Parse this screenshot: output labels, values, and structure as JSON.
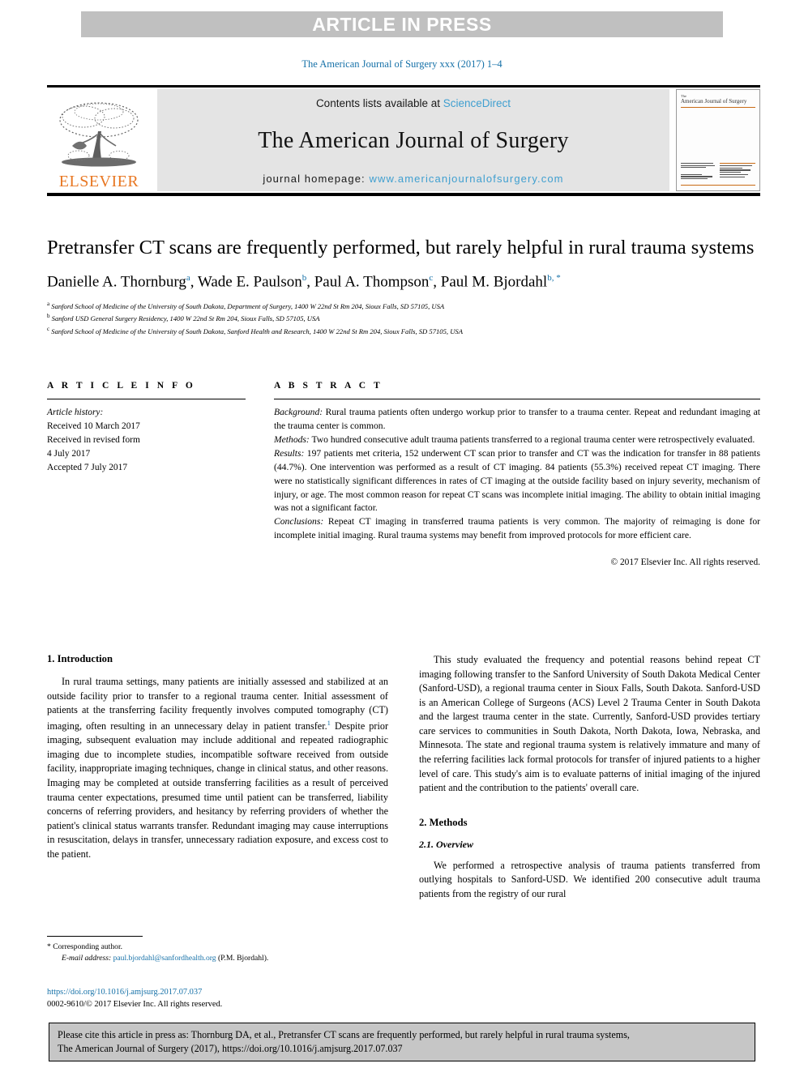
{
  "banner": {
    "text": "ARTICLE IN PRESS"
  },
  "running_head": "The American Journal of Surgery xxx (2017) 1–4",
  "masthead": {
    "contents_prefix": "Contents lists available at ",
    "sciencedirect": "ScienceDirect",
    "journal_title": "The American Journal of Surgery",
    "homepage_prefix": "journal homepage: ",
    "homepage_url": "www.americanjournalofsurgery.com",
    "publisher_logo_text": "ELSEVIER",
    "cover_title_small": "The",
    "cover_title_main": "American Journal of Surgery"
  },
  "article": {
    "title": "Pretransfer CT scans are frequently performed, but rarely helpful in rural trauma systems",
    "authors": [
      {
        "name": "Danielle A. Thornburg",
        "mark": "a"
      },
      {
        "name": "Wade E. Paulson",
        "mark": "b"
      },
      {
        "name": "Paul A. Thompson",
        "mark": "c"
      },
      {
        "name": "Paul M. Bjordahl",
        "mark": "b, *"
      }
    ],
    "affiliations": [
      {
        "mark": "a",
        "text": "Sanford School of Medicine of the University of South Dakota, Department of Surgery, 1400 W 22nd St Rm 204, Sioux Falls, SD 57105, USA"
      },
      {
        "mark": "b",
        "text": "Sanford USD General Surgery Residency, 1400 W 22nd St Rm 204, Sioux Falls, SD 57105, USA"
      },
      {
        "mark": "c",
        "text": "Sanford School of Medicine of the University of South Dakota, Sanford Health and Research, 1400 W 22nd St Rm 204, Sioux Falls, SD 57105, USA"
      }
    ]
  },
  "article_info": {
    "heading": "A R T I C L E   I N F O",
    "history_label": "Article history:",
    "history_lines": [
      "Received 10 March 2017",
      "Received in revised form",
      "4 July 2017",
      "Accepted 7 July 2017"
    ]
  },
  "abstract": {
    "heading": "A B S T R A C T",
    "sections": [
      {
        "label": "Background:",
        "text": " Rural trauma patients often undergo workup prior to transfer to a trauma center. Repeat and redundant imaging at the trauma center is common."
      },
      {
        "label": "Methods:",
        "text": " Two hundred consecutive adult trauma patients transferred to a regional trauma center were retrospectively evaluated."
      },
      {
        "label": "Results:",
        "text": " 197 patients met criteria, 152 underwent CT scan prior to transfer and CT was the indication for transfer in 88 patients (44.7%). One intervention was performed as a result of CT imaging. 84 patients (55.3%) received repeat CT imaging. There were no statistically significant differences in rates of CT imaging at the outside facility based on injury severity, mechanism of injury, or age. The most common reason for repeat CT scans was incomplete initial imaging. The ability to obtain initial imaging was not a significant factor."
      },
      {
        "label": "Conclusions:",
        "text": " Repeat CT imaging in transferred trauma patients is very common. The majority of reimaging is done for incomplete initial imaging. Rural trauma systems may benefit from improved protocols for more efficient care."
      }
    ],
    "copyright": "© 2017 Elsevier Inc. All rights reserved."
  },
  "body": {
    "left_column": {
      "section_heading": "1. Introduction",
      "paragraph_1_part1": "In rural trauma settings, many patients are initially assessed and stabilized at an outside facility prior to transfer to a regional trauma center. Initial assessment of patients at the transferring facility frequently involves computed tomography (CT) imaging, often resulting in an unnecessary delay in patient transfer.",
      "paragraph_1_ref": "1",
      "paragraph_1_part2": " Despite prior imaging, subsequent evaluation may include additional and repeated radiographic imaging due to incomplete studies, incompatible software received from outside facility, inappropriate imaging techniques, change in clinical status, and other reasons. Imaging may be completed at outside transferring facilities as a result of perceived trauma center expectations, presumed time until patient can be transferred, liability concerns of referring providers, and hesitancy by referring providers of whether the patient's clinical status warrants transfer. Redundant imaging may cause interruptions in resuscitation, delays in transfer, unnecessary radiation exposure, and excess cost to the patient."
    },
    "right_column": {
      "paragraph_1": "This study evaluated the frequency and potential reasons behind repeat CT imaging following transfer to the Sanford University of South Dakota Medical Center (Sanford-USD), a regional trauma center in Sioux Falls, South Dakota. Sanford-USD is an American College of Surgeons (ACS) Level 2 Trauma Center in South Dakota and the largest trauma center in the state. Currently, Sanford-USD provides tertiary care services to communities in South Dakota, North Dakota, Iowa, Nebraska, and Minnesota. The state and regional trauma system is relatively immature and many of the referring facilities lack formal protocols for transfer of injured patients to a higher level of care. This study's aim is to evaluate patterns of initial imaging of the injured patient and the contribution to the patients' overall care.",
      "section_heading": "2. Methods",
      "subsection_heading": "2.1. Overview",
      "paragraph_2": "We performed a retrospective analysis of trauma patients transferred from outlying hospitals to Sanford-USD. We identified 200 consecutive adult trauma patients from the registry of our rural"
    }
  },
  "footnote": {
    "corresponding_marker": "*",
    "corresponding_label": "Corresponding author.",
    "email_label": "E-mail address:",
    "email": "paul.bjordahl@sanfordhealth.org",
    "email_suffix": " (P.M. Bjordahl)."
  },
  "doi_block": {
    "doi_url": "https://doi.org/10.1016/j.amjsurg.2017.07.037",
    "issn_line": "0002-9610/© 2017 Elsevier Inc. All rights reserved."
  },
  "citation_box": {
    "line1": "Please cite this article in press as: Thornburg DA, et al., Pretransfer CT scans are frequently performed, but rarely helpful in rural trauma systems,",
    "line2": "The American Journal of Surgery (2017), https://doi.org/10.1016/j.amjsurg.2017.07.037"
  },
  "colors": {
    "link": "#1671a8",
    "sciencedirect": "#3f9fd0",
    "elsevier_orange": "#e87722",
    "banner_bg": "#c0c0c0",
    "masthead_bg": "#e4e4e4",
    "cite_bg": "#c6c6c6"
  }
}
